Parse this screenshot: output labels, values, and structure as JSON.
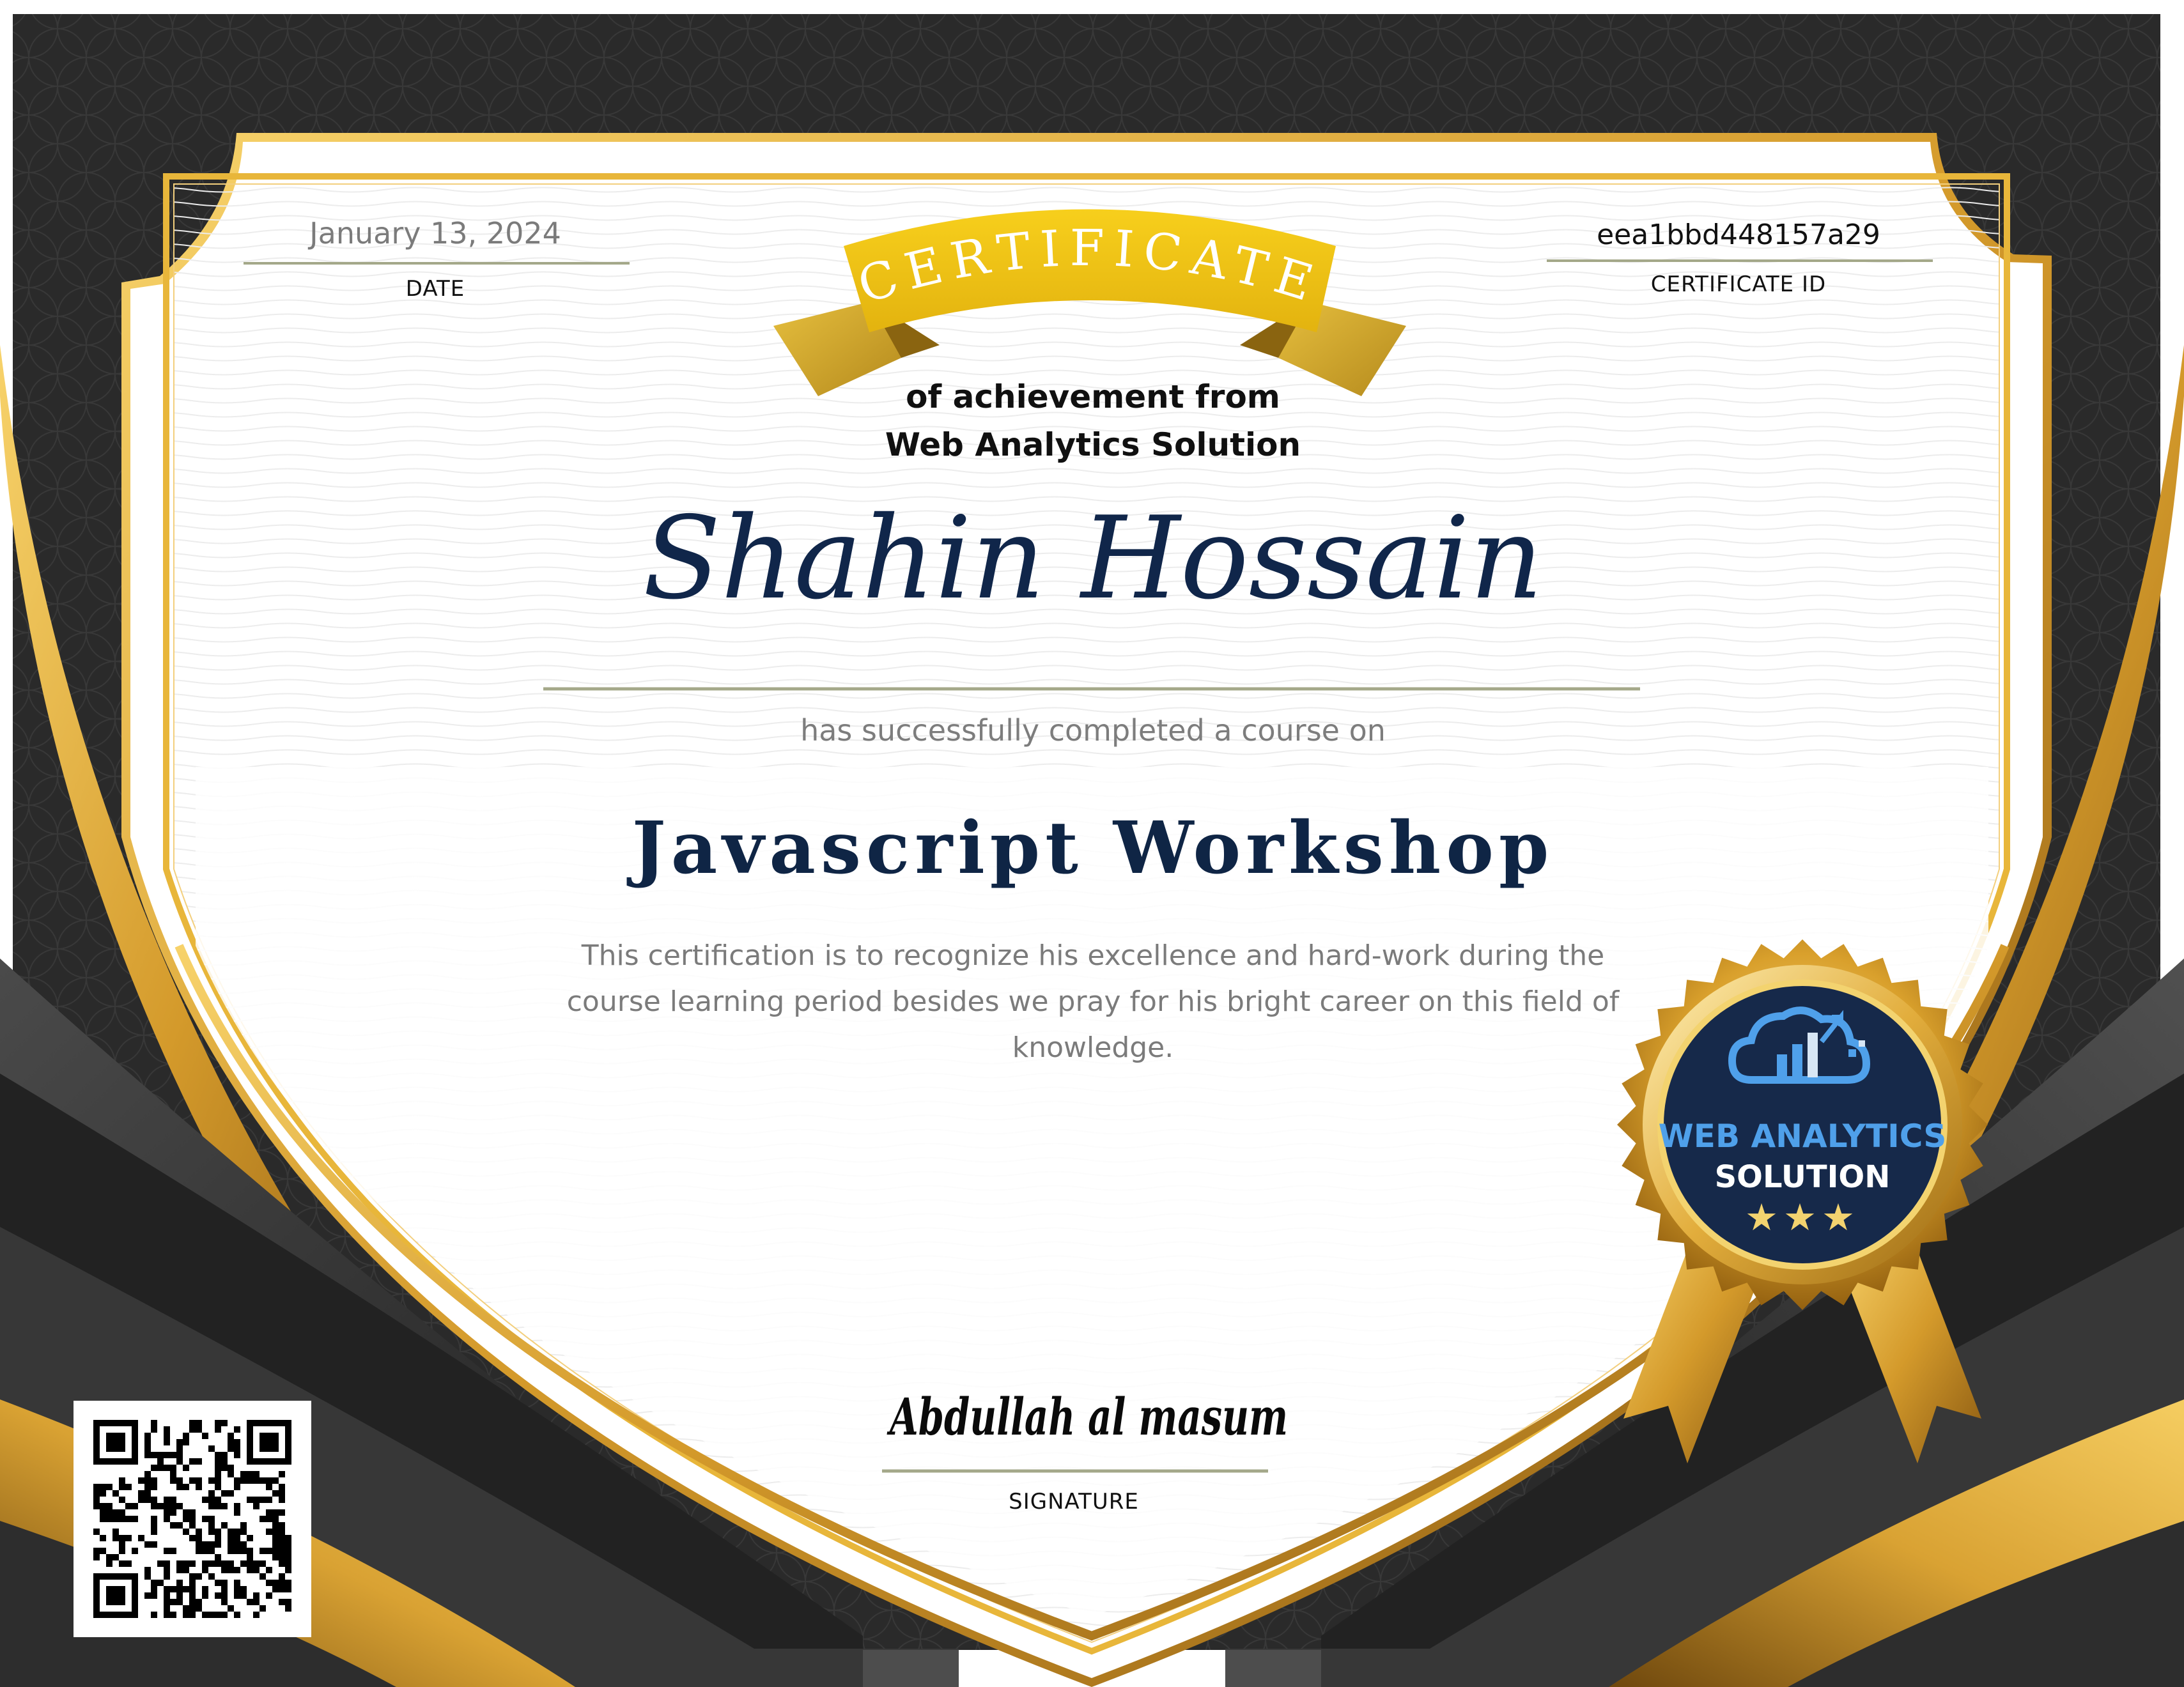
{
  "certificate": {
    "date": {
      "value": "January 13, 2024",
      "label": "DATE"
    },
    "certificate_id": {
      "value": "eea1bbd448157a29",
      "label": "CERTIFICATE ID"
    },
    "ribbon_title": "CERTIFICATE",
    "subtitle_line1": "of achievement from",
    "subtitle_line2": "Web Analytics Solution",
    "recipient_name": "Shahin Hossain",
    "completion_text": "has successfully completed a course on",
    "course_name": "Javascript Workshop",
    "description": "This certification is to recognize his excellence and hard-work during the course learning period besides we pray for his bright career on this field of knowledge.",
    "signature": {
      "name": "Abdullah al masum",
      "label": "SIGNATURE"
    },
    "seal": {
      "line1": "WEB ANALYTICS",
      "line2": "SOLUTION",
      "stars": "★★★",
      "icon": "cloud-chart-icon"
    },
    "qr_code": {
      "icon": "qr-code-icon"
    }
  },
  "colors": {
    "gold": "#e9b73a",
    "dark_gold": "#b07d1f",
    "ribbon_yellow": "#efc316",
    "dark_band": "#2b2b2b",
    "navy": "#0f2545",
    "seal_blue": "#16294a",
    "accent_blue": "#4fa0ea"
  }
}
